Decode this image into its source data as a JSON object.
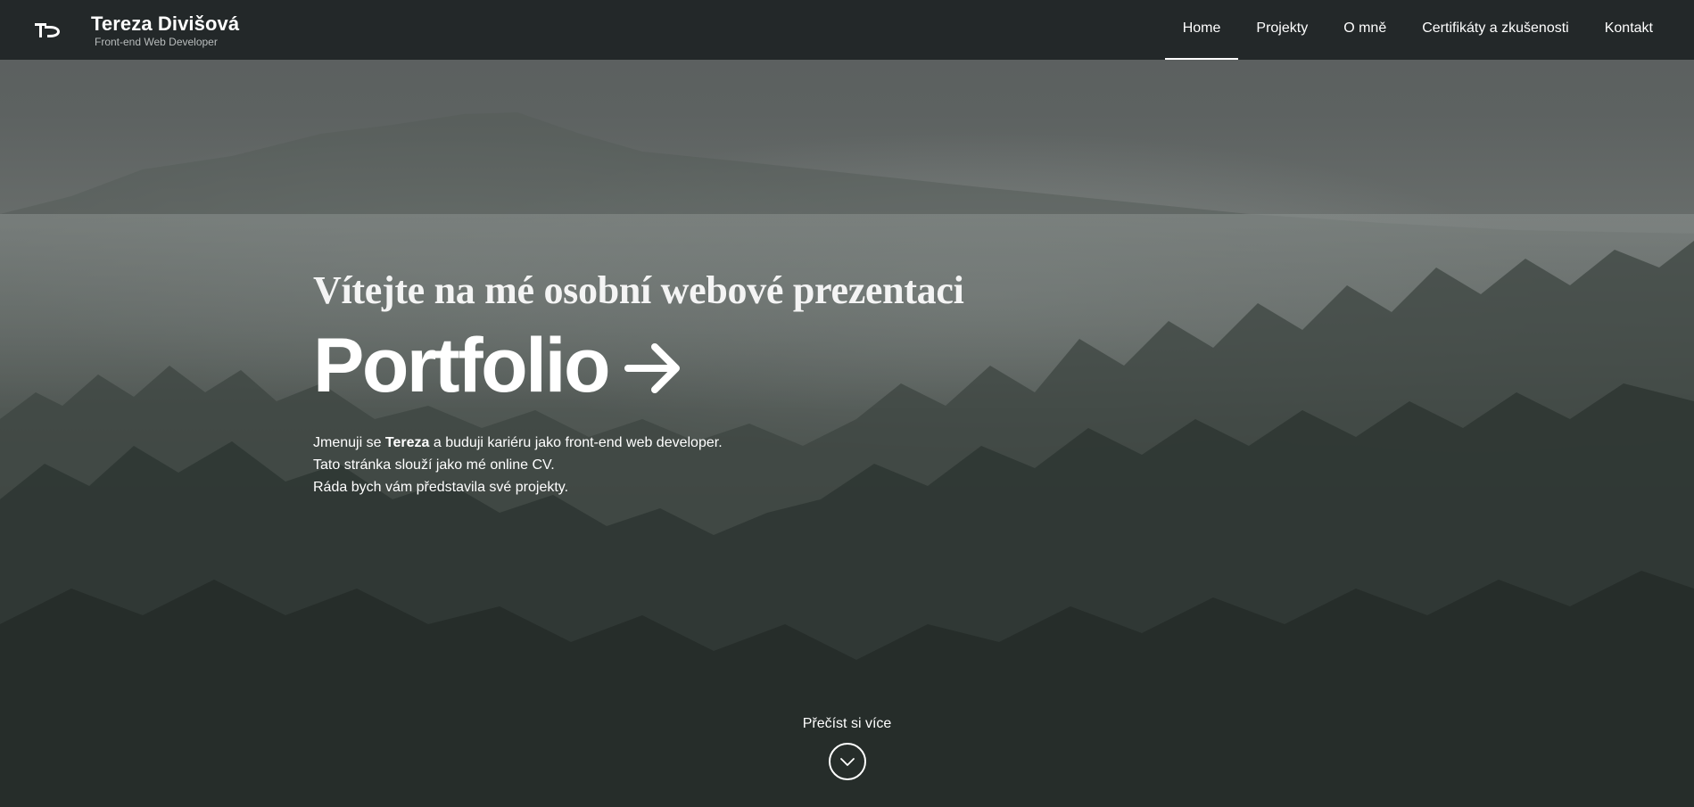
{
  "header": {
    "logo_text": "TD",
    "name": "Tereza Divišová",
    "subtitle": "Front-end Web Developer"
  },
  "nav": {
    "items": [
      {
        "label": "Home",
        "active": true
      },
      {
        "label": "Projekty",
        "active": false
      },
      {
        "label": "O mně",
        "active": false
      },
      {
        "label": "Certifikáty a zkušenosti",
        "active": false
      },
      {
        "label": "Kontakt",
        "active": false
      }
    ]
  },
  "hero": {
    "welcome": "Vítejte na mé osobní webové prezentaci",
    "title": "Portfolio",
    "arrow_icon": "arrow-right-icon",
    "intro": {
      "line1_before": "Jmenuji se ",
      "line1_bold": "Tereza",
      "line1_after": " a buduji kariéru jako front-end web developer.",
      "line2": "Tato stránka slouží jako mé online CV.",
      "line3": "Ráda bych vám představila své projekty."
    }
  },
  "read_more": {
    "label": "Přečíst si více",
    "icon": "chevron-down-icon"
  },
  "colors": {
    "navbar_bg": "#232829",
    "text": "#ffffff",
    "subtitle": "#b9bdbd"
  }
}
